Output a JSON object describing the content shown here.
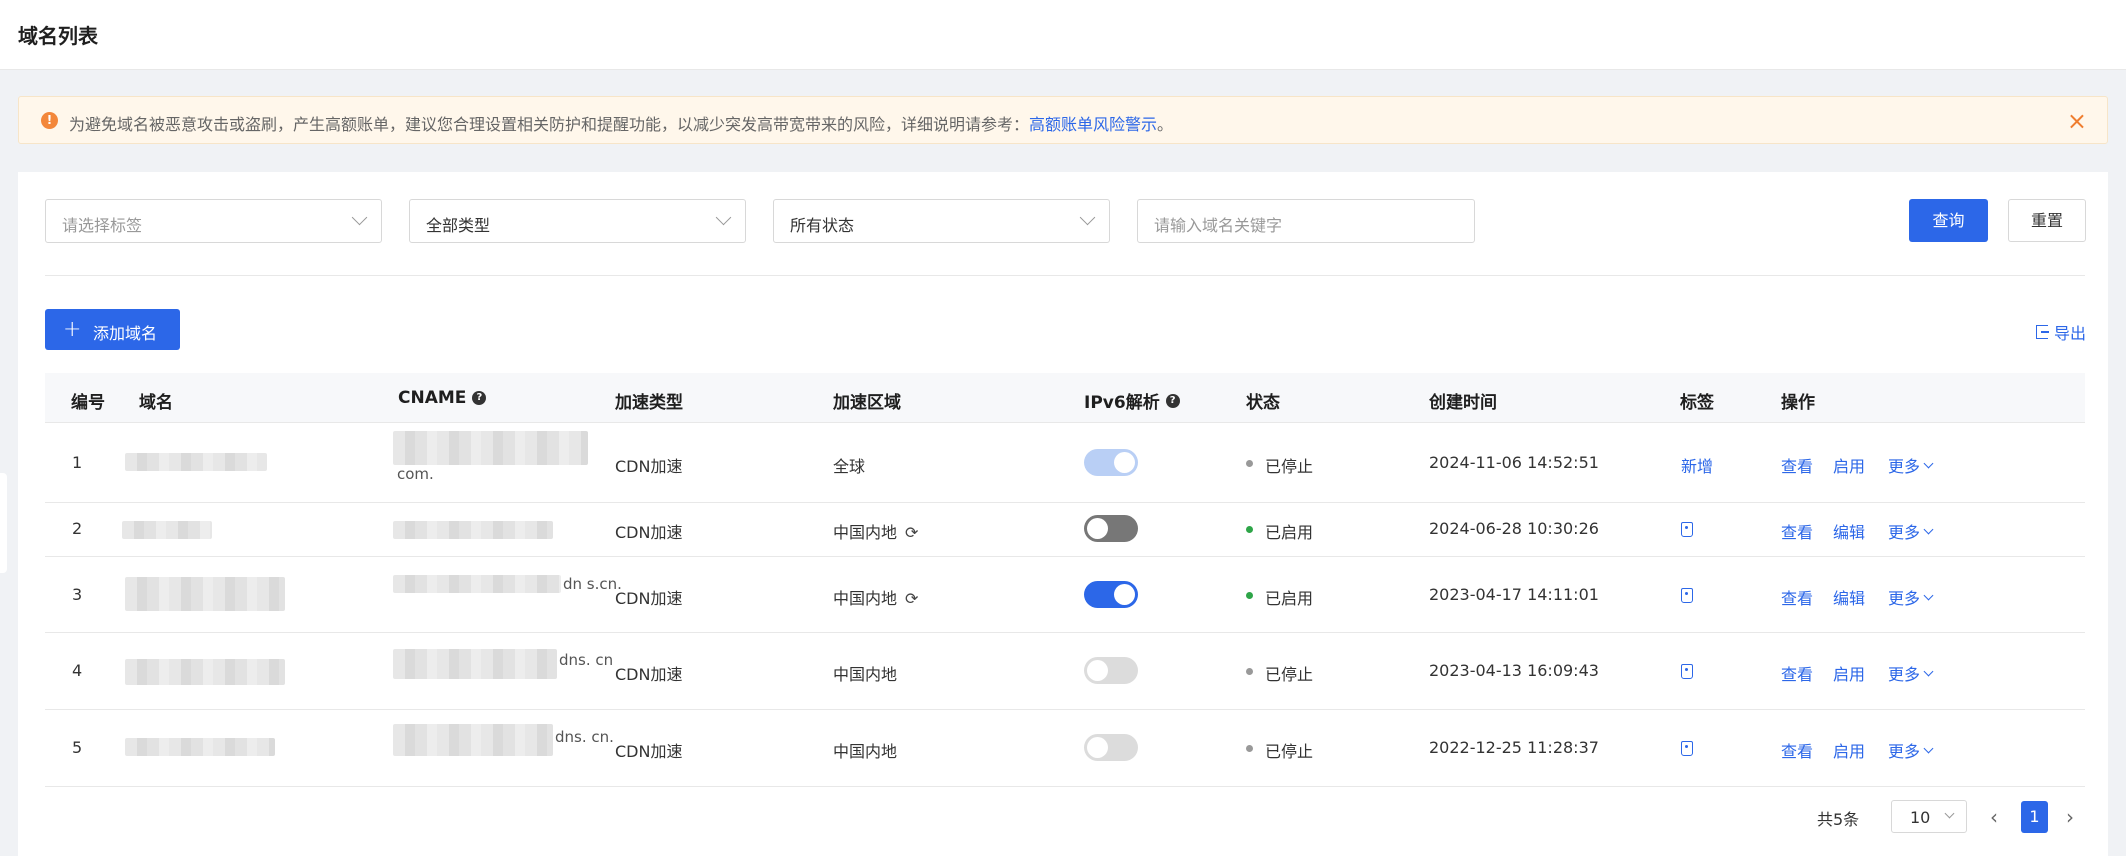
{
  "page": {
    "title": "域名列表"
  },
  "alert": {
    "icon": "!",
    "text": "为避免域名被恶意攻击或盗刷，产生高额账单，建议您合理设置相关防护和提醒功能，以减少突发高带宽带来的风险，详细说明请参考：",
    "link": "高额账单风险警示",
    "suffix": "。",
    "close": "×",
    "accent": "#ef7d2e"
  },
  "filters": {
    "tag_placeholder": "请选择标签",
    "type_value": "全部类型",
    "status_value": "所有状态",
    "keyword_placeholder": "请输入域名关键字",
    "query_label": "查询",
    "reset_label": "重置"
  },
  "toolbar": {
    "add_label": "添加域名",
    "export_label": "导出"
  },
  "table": {
    "headers": {
      "id": "编号",
      "domain": "域名",
      "cname": "CNAME",
      "type": "加速类型",
      "region": "加速区域",
      "ipv6": "IPv6解析",
      "status": "状态",
      "created": "创建时间",
      "tag": "标签",
      "ops": "操作"
    },
    "rows": [
      {
        "id": "1",
        "cname_tail": "com.",
        "type": "CDN加速",
        "region": "全球",
        "ipv6": "on-disabled",
        "status": "已停止",
        "status_color": "#999999",
        "created": "2024-11-06 14:52:51",
        "tag_text": "新增",
        "op_view": "查看",
        "op_second": "启用",
        "op_more": "更多"
      },
      {
        "id": "2",
        "cname_tail": "",
        "type": "CDN加速",
        "region": "中国内地",
        "ipv6": "off-dark",
        "status": "已启用",
        "status_color": "#2ea548",
        "created": "2024-06-28 10:30:26",
        "tag_text": "",
        "op_view": "查看",
        "op_second": "编辑",
        "op_more": "更多"
      },
      {
        "id": "3",
        "cname_tail": "dn s.cn.",
        "type": "CDN加速",
        "region": "中国内地",
        "ipv6": "on",
        "status": "已启用",
        "status_color": "#2ea548",
        "created": "2023-04-17 14:11:01",
        "tag_text": "",
        "op_view": "查看",
        "op_second": "编辑",
        "op_more": "更多"
      },
      {
        "id": "4",
        "cname_tail": "dns. cn",
        "type": "CDN加速",
        "region": "中国内地",
        "ipv6": "off-light",
        "status": "已停止",
        "status_color": "#999999",
        "created": "2023-04-13 16:09:43",
        "tag_text": "",
        "op_view": "查看",
        "op_second": "启用",
        "op_more": "更多"
      },
      {
        "id": "5",
        "cname_tail": "dns. cn.",
        "type": "CDN加速",
        "region": "中国内地",
        "ipv6": "off-light",
        "status": "已停止",
        "status_color": "#999999",
        "created": "2022-12-25 11:28:37",
        "tag_text": "",
        "op_view": "查看",
        "op_second": "启用",
        "op_more": "更多"
      }
    ]
  },
  "pagination": {
    "total": "共5条",
    "page_size": "10",
    "current": "1",
    "prev": "‹",
    "next": "›"
  },
  "colors": {
    "primary": "#2c67e8"
  }
}
